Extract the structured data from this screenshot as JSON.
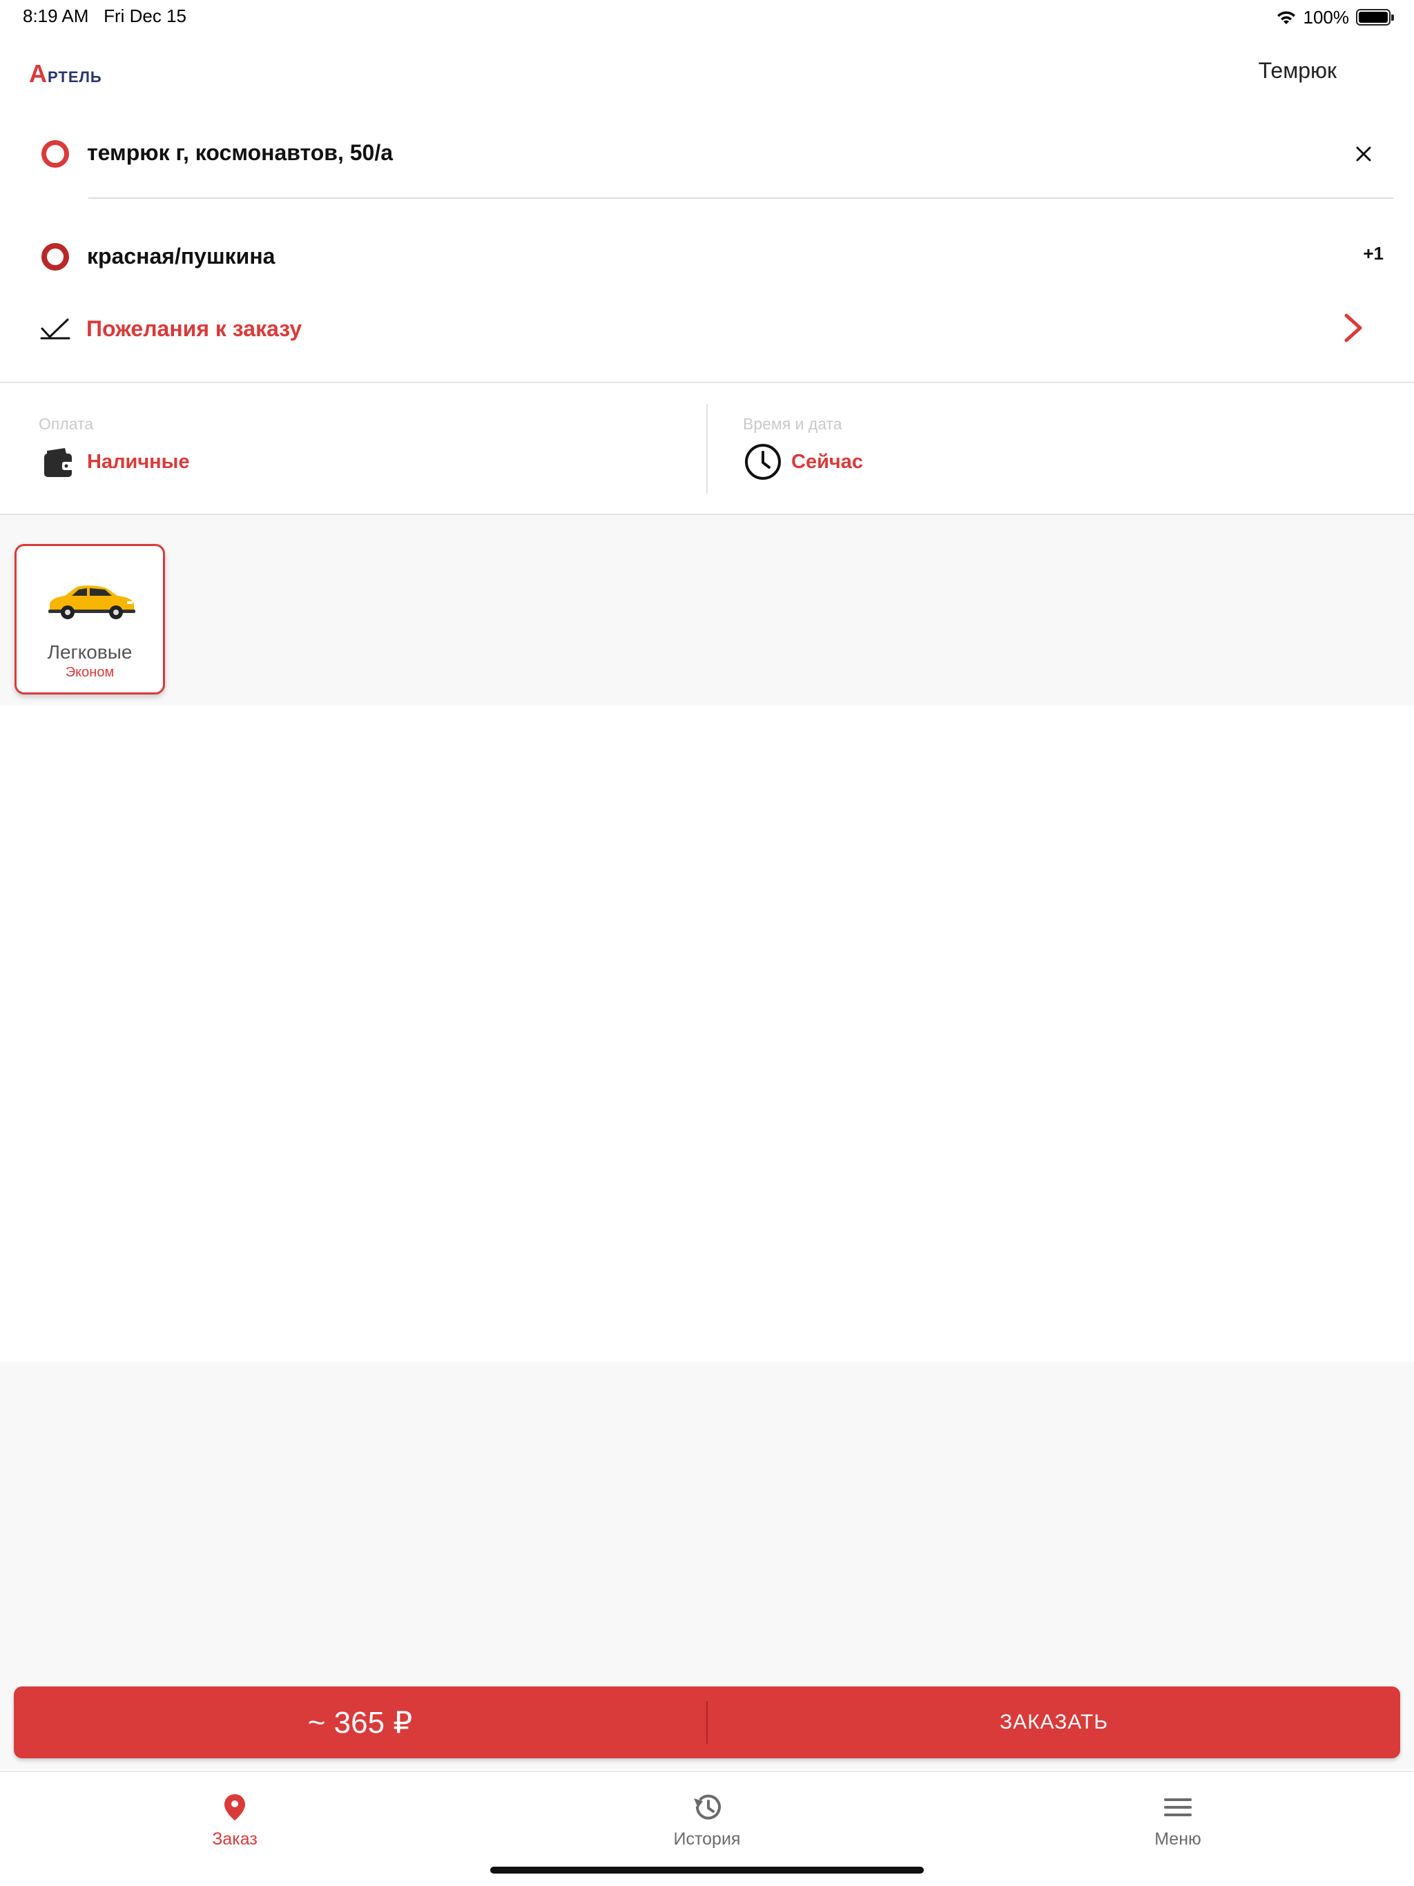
{
  "status_bar": {
    "time": "8:19 AM",
    "date": "Fri Dec 15",
    "battery": "100%"
  },
  "header": {
    "logo_first": "А",
    "logo_rest": "ртель",
    "city": "Темрюк"
  },
  "route": {
    "from": "темрюк г, космонавтов, 50/а",
    "to": "красная/пушкина",
    "extra_stops": "+1",
    "wishes_label": "Пожелания к заказу"
  },
  "payment": {
    "label": "Оплата",
    "value": "Наличные"
  },
  "time": {
    "label": "Время и дата",
    "value": "Сейчас"
  },
  "car_classes": [
    {
      "title": "Легковые",
      "subtitle": "Эконом",
      "selected": true
    }
  ],
  "order": {
    "price": "~ 365 ₽",
    "button_label": "ЗАКАЗАТЬ"
  },
  "tabs": [
    {
      "label": "Заказ",
      "icon": "location-pin-icon",
      "active": true
    },
    {
      "label": "История",
      "icon": "history-icon",
      "active": false
    },
    {
      "label": "Меню",
      "icon": "hamburger-menu-icon",
      "active": false
    }
  ],
  "colors": {
    "accent": "#d93a3a",
    "logo_blue": "#27356e",
    "inactive_tab": "#6b6b6b"
  }
}
